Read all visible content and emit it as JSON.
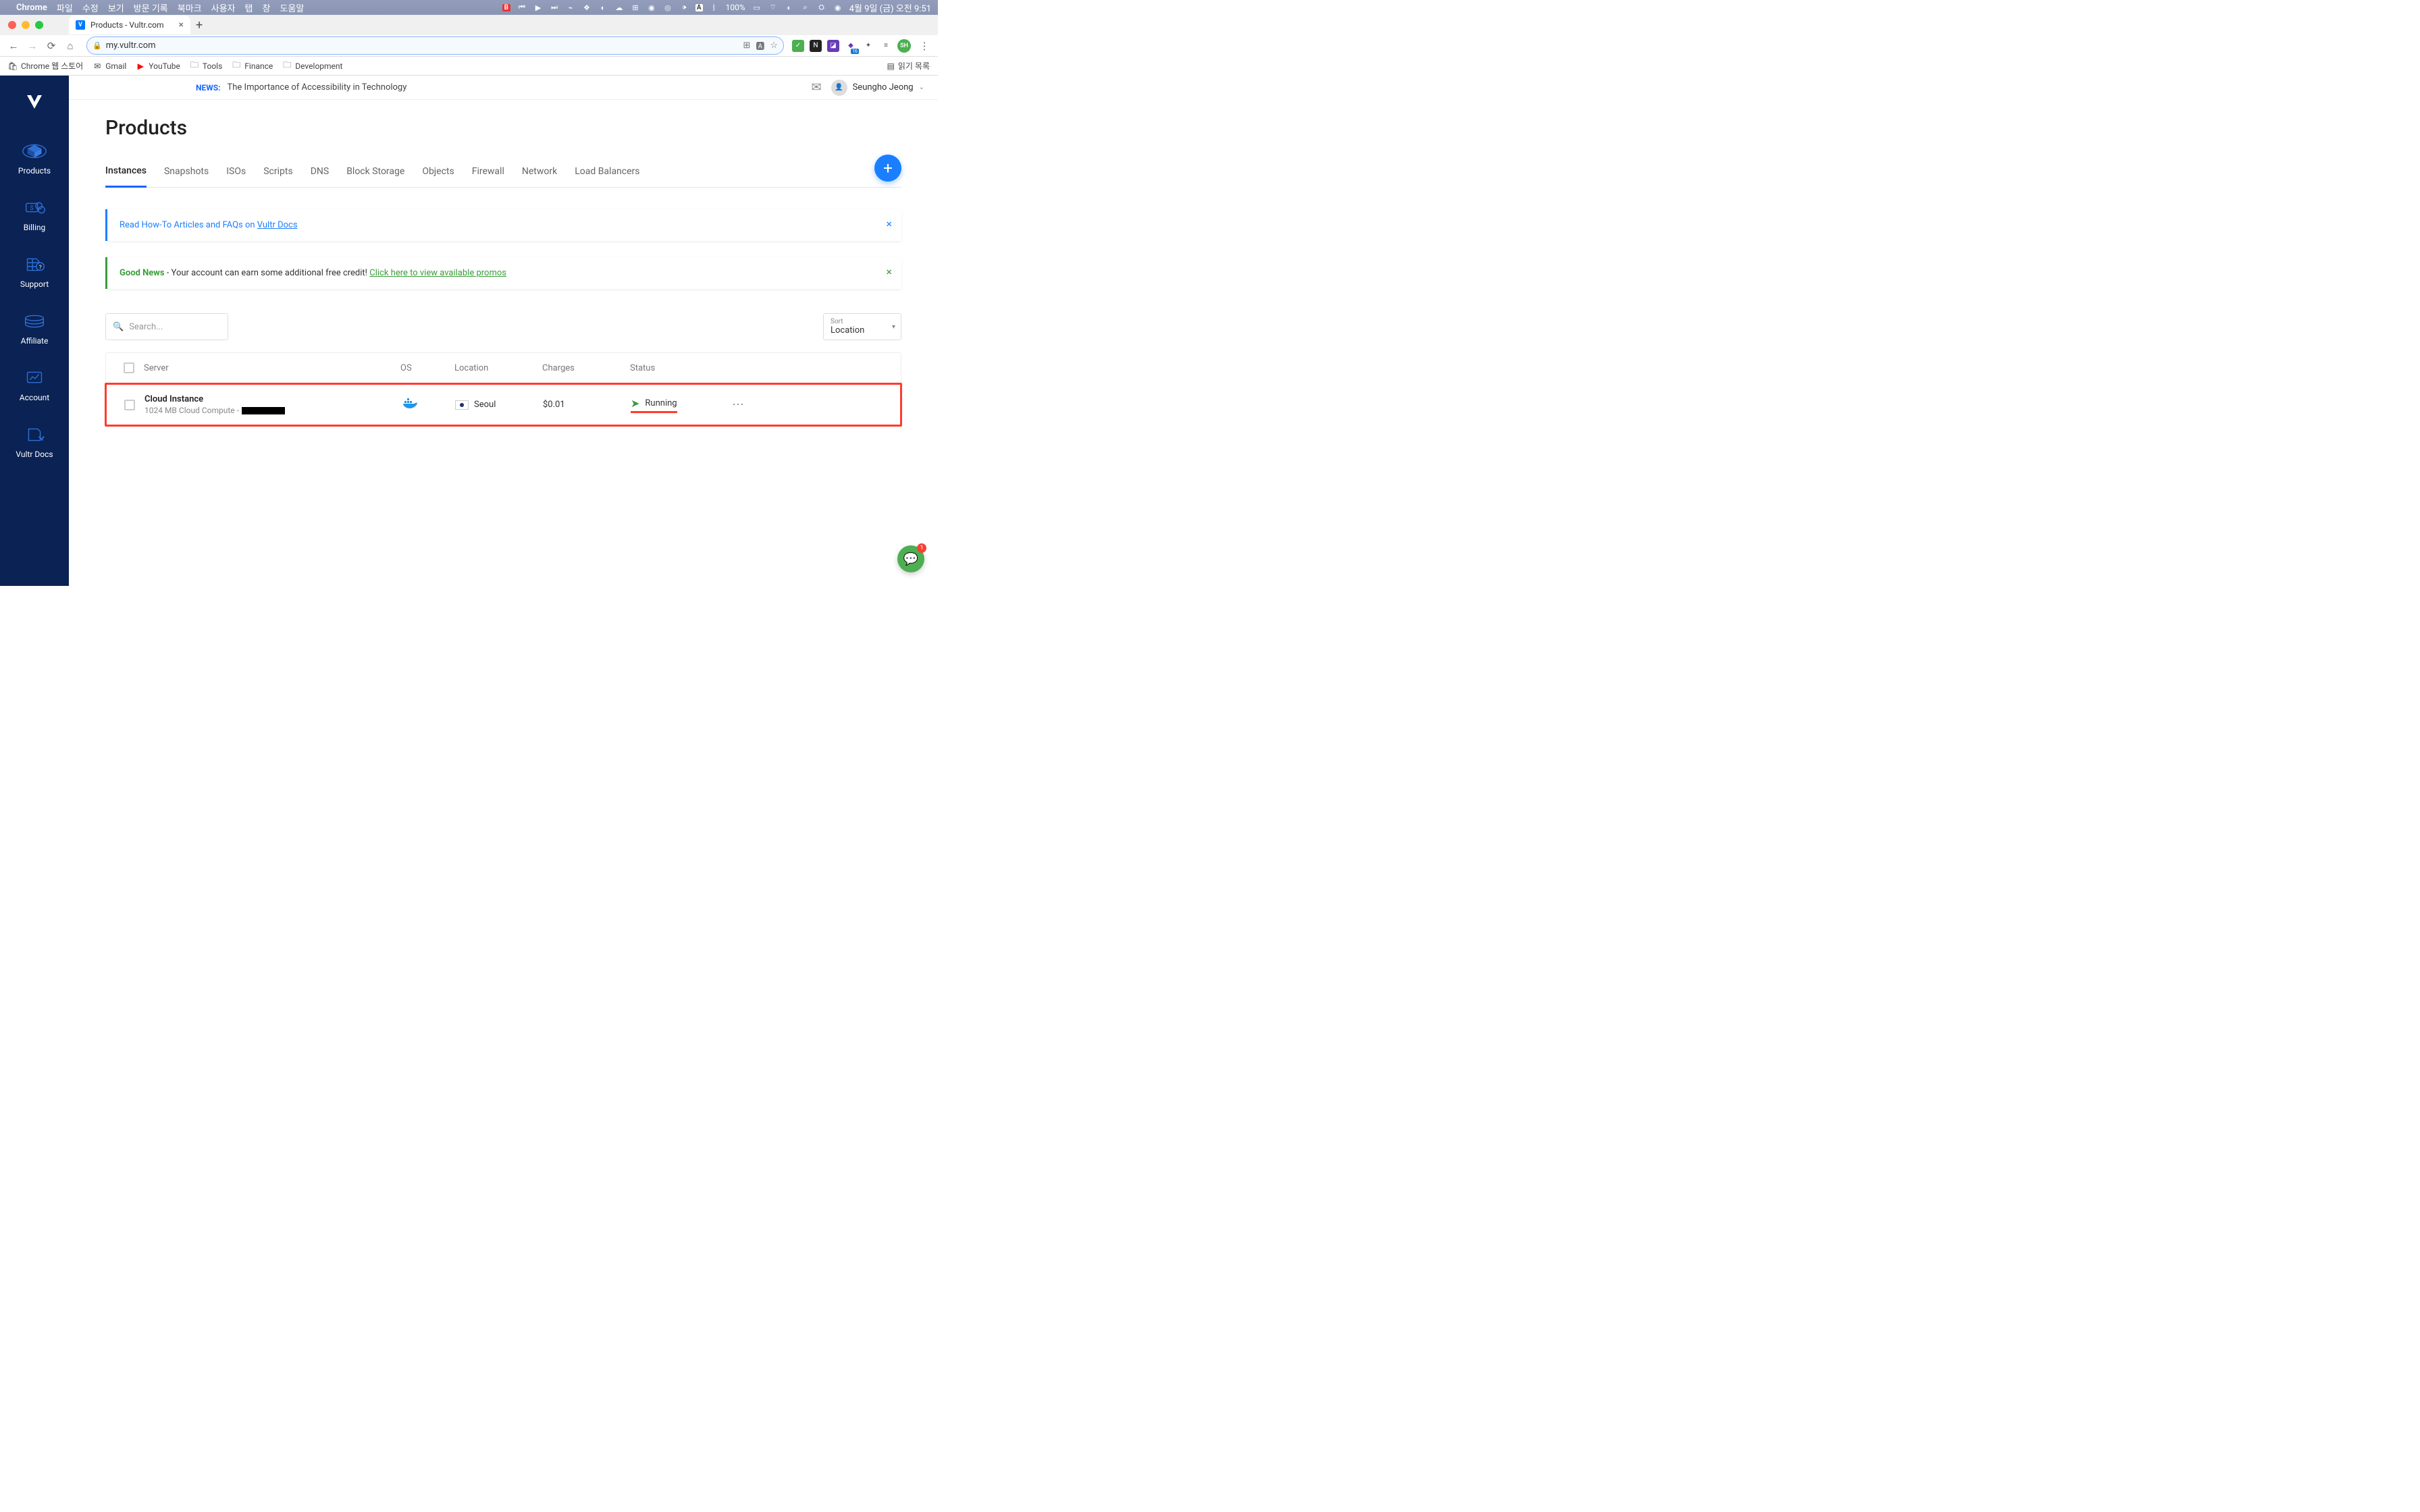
{
  "menubar": {
    "app": "Chrome",
    "menus": [
      "파일",
      "수정",
      "보기",
      "방문 기록",
      "북마크",
      "사용자",
      "탭",
      "창",
      "도움말"
    ],
    "battery": "100%",
    "datetime": "4월 9일 (금) 오전 9:51"
  },
  "browser": {
    "tab_title": "Products - Vultr.com",
    "url": "my.vultr.com",
    "bookmarks": [
      {
        "icon": "webstore",
        "label": "Chrome 웹 스토어"
      },
      {
        "icon": "gmail",
        "label": "Gmail"
      },
      {
        "icon": "youtube",
        "label": "YouTube"
      },
      {
        "icon": "folder",
        "label": "Tools"
      },
      {
        "icon": "folder",
        "label": "Finance"
      },
      {
        "icon": "folder",
        "label": "Development"
      }
    ],
    "reading_list": "읽기 목록",
    "avatar_initials": "SH"
  },
  "sidebar": {
    "items": [
      {
        "label": "Products"
      },
      {
        "label": "Billing"
      },
      {
        "label": "Support"
      },
      {
        "label": "Affiliate"
      },
      {
        "label": "Account"
      },
      {
        "label": "Vultr Docs"
      }
    ]
  },
  "topbar": {
    "news_label": "NEWS:",
    "news_text": "The Importance of Accessibility in Technology",
    "user_name": "Seungho Jeong"
  },
  "page": {
    "title": "Products",
    "tabs": [
      "Instances",
      "Snapshots",
      "ISOs",
      "Scripts",
      "DNS",
      "Block Storage",
      "Objects",
      "Firewall",
      "Network",
      "Load Balancers"
    ]
  },
  "alerts": {
    "docs_prefix": "Read How-To Articles and FAQs on ",
    "docs_link": "Vultr Docs",
    "goodnews_bold": "Good News",
    "goodnews_text": " - Your account can earn some additional free credit!  ",
    "goodnews_link": "Click here to view available promos"
  },
  "controls": {
    "search_placeholder": "Search...",
    "sort_label": "Sort",
    "sort_value": "Location"
  },
  "table": {
    "headers": {
      "server": "Server",
      "os": "OS",
      "location": "Location",
      "charges": "Charges",
      "status": "Status"
    },
    "rows": [
      {
        "name": "Cloud Instance",
        "spec": "1024 MB Cloud Compute - ",
        "location": "Seoul",
        "charges": "$0.01",
        "status": "Running"
      }
    ]
  },
  "chat": {
    "badge": "1"
  }
}
